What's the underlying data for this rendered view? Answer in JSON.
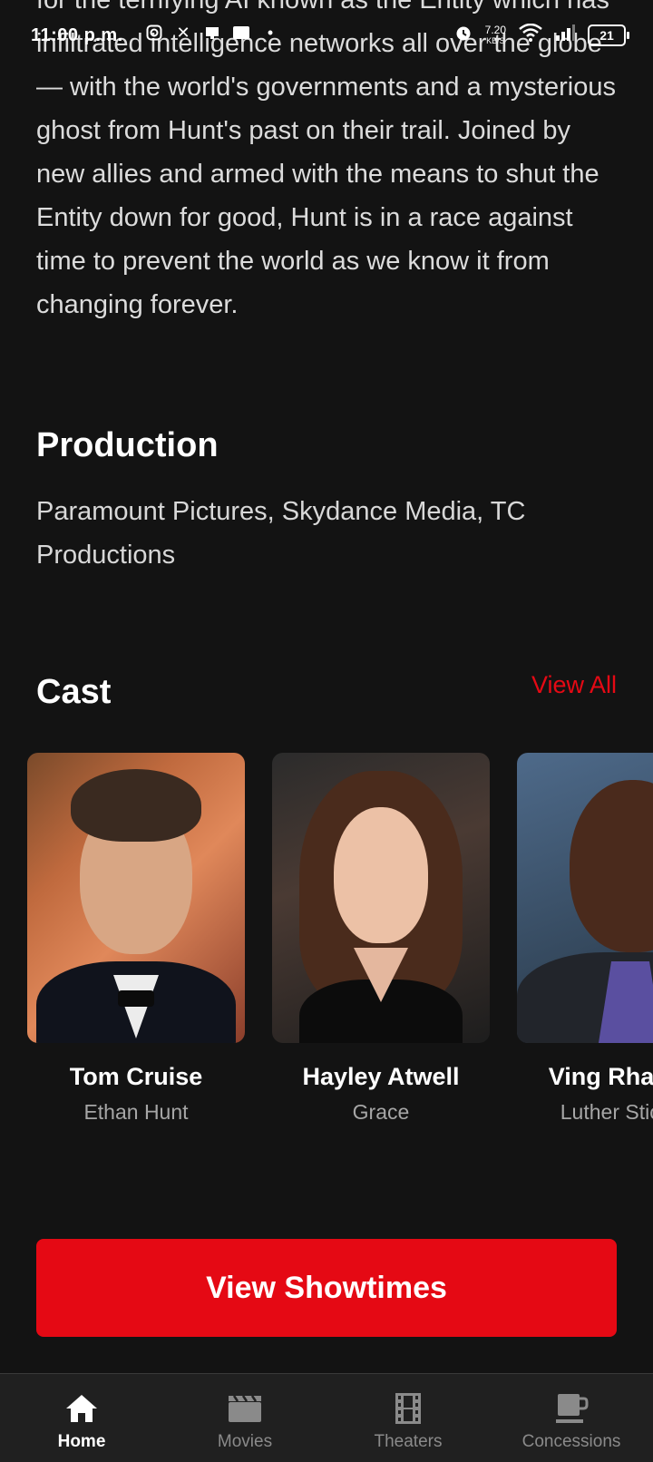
{
  "status_bar": {
    "time": "11:00 p.m.",
    "speed_value": "7.20",
    "speed_unit": "KB/S",
    "battery": "21"
  },
  "overview": {
    "text": "for the terrifying AI known as the Entity which has infiltrated intelligence networks all over the globe — with the world's governments and a mysterious ghost from Hunt's past on their trail. Joined by new allies and armed with the means to shut the Entity down for good, Hunt is in a race against time to prevent the world as we know it from changing forever."
  },
  "production": {
    "title": "Production",
    "companies": "Paramount Pictures, Skydance Media, TC Productions"
  },
  "cast": {
    "title": "Cast",
    "view_all_label": "View All",
    "members": [
      {
        "name": "Tom Cruise",
        "role": "Ethan Hunt"
      },
      {
        "name": "Hayley Atwell",
        "role": "Grace"
      },
      {
        "name": "Ving Rhames",
        "role": "Luther Stickell"
      }
    ]
  },
  "actions": {
    "showtimes_label": "View Showtimes"
  },
  "bottom_nav": {
    "items": [
      {
        "label": "Home",
        "icon": "home-icon",
        "active": true
      },
      {
        "label": "Movies",
        "icon": "clapperboard-icon",
        "active": false
      },
      {
        "label": "Theaters",
        "icon": "film-strip-icon",
        "active": false
      },
      {
        "label": "Concessions",
        "icon": "coffee-cup-icon",
        "active": false
      }
    ]
  },
  "colors": {
    "background": "#131313",
    "accent": "#e50914",
    "nav_background": "#202020",
    "muted_text": "#a6a6a6"
  }
}
